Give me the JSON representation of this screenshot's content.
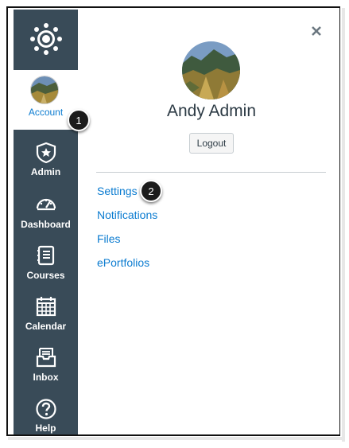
{
  "nav": {
    "account_label": "Account",
    "items": [
      {
        "label": "Admin",
        "icon": "admin-shield-icon"
      },
      {
        "label": "Dashboard",
        "icon": "dashboard-gauge-icon"
      },
      {
        "label": "Courses",
        "icon": "courses-book-icon"
      },
      {
        "label": "Calendar",
        "icon": "calendar-icon"
      },
      {
        "label": "Inbox",
        "icon": "inbox-icon"
      },
      {
        "label": "Help",
        "icon": "help-question-icon"
      }
    ]
  },
  "profile": {
    "name": "Andy Admin",
    "logout_label": "Logout"
  },
  "menu": {
    "links": [
      "Settings",
      "Notifications",
      "Files",
      "ePortfolios"
    ]
  },
  "callouts": [
    "1",
    "2"
  ],
  "colors": {
    "sidebar": "#394b58",
    "link": "#0a7bd0",
    "text": "#2d3b45"
  }
}
